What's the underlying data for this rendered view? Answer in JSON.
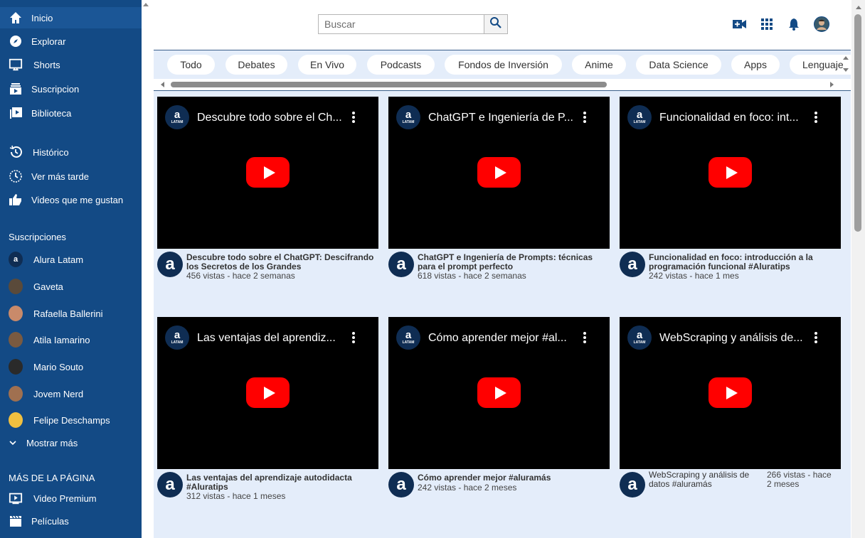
{
  "sidebar": {
    "nav": [
      {
        "label": "Inicio",
        "icon": "home-icon"
      },
      {
        "label": "Explorar",
        "icon": "compass-icon"
      },
      {
        "label": "Shorts",
        "icon": "shorts-icon"
      },
      {
        "label": "Suscripcion",
        "icon": "subscriptions-icon"
      },
      {
        "label": "Biblioteca",
        "icon": "library-icon"
      }
    ],
    "library": [
      {
        "label": "Histórico",
        "icon": "history-icon"
      },
      {
        "label": "Ver más tarde",
        "icon": "clock-icon"
      },
      {
        "label": "Videos que me gustan",
        "icon": "thumbs-up-icon"
      }
    ],
    "subs_heading": "Suscripciones",
    "subs": [
      {
        "label": "Alura Latam",
        "color": "#0f2d53"
      },
      {
        "label": "Gaveta",
        "color": "#5a4a3a"
      },
      {
        "label": "Rafaella Ballerini",
        "color": "#c98a6a"
      },
      {
        "label": "Atila Iamarino",
        "color": "#7a5a40"
      },
      {
        "label": "Mario Souto",
        "color": "#2a2a2a"
      },
      {
        "label": "Jovem Nerd",
        "color": "#a07050"
      },
      {
        "label": "Felipe Deschamps",
        "color": "#f0c040"
      }
    ],
    "show_more": "Mostrar más",
    "more_heading": "MÁS DE LA PÁGINA",
    "more": [
      {
        "label": "Video Premium",
        "icon": "premium-icon"
      },
      {
        "label": "Películas",
        "icon": "clapperboard-icon"
      }
    ]
  },
  "header": {
    "search_placeholder": "Buscar",
    "icons": [
      "create-video-icon",
      "apps-grid-icon",
      "bell-icon",
      "avatar"
    ]
  },
  "chips": [
    "Todo",
    "Debates",
    "En Vivo",
    "Podcasts",
    "Fondos de Inversión",
    "Anime",
    "Data Science",
    "Apps",
    "Lenguaje"
  ],
  "videos": [
    {
      "player_title": "Descubre todo sobre el Ch...",
      "title": "Descubre todo sobre el ChatGPT: Descifrando los Secretos de los Grandes",
      "sub": "456 vistas - hace 2 semanas"
    },
    {
      "player_title": "ChatGPT e Ingeniería de P...",
      "title": "ChatGPT e Ingeniería de Prompts: técnicas para el prompt perfecto",
      "sub": "618 vistas - hace 2 semanas"
    },
    {
      "player_title": "Funcionalidad en foco: int...",
      "title": "Funcionalidad en foco: introducción a la programación funcional #Aluratips",
      "sub": "242 vistas - hace 1 mes"
    },
    {
      "player_title": "Las ventajas del aprendiz...",
      "title": "Las ventajas del aprendizaje autodidacta #Aluratips",
      "sub": "312 vistas - hace 1 meses"
    },
    {
      "player_title": "Cómo aprender mejor #al...",
      "title": "Cómo aprender mejor #aluramás",
      "sub": "242 vistas - hace 2 meses"
    },
    {
      "player_title": "WebScraping y análisis de...",
      "title": "WebScraping y análisis de datos #aluramás",
      "sub": "266 vistas - hace 2 meses"
    }
  ],
  "logo_letter": "a",
  "logo_tag": "LATAM",
  "colors": {
    "sidebar": "#134a85",
    "content_bg": "#e4edfa",
    "play_red": "#ff0000"
  }
}
